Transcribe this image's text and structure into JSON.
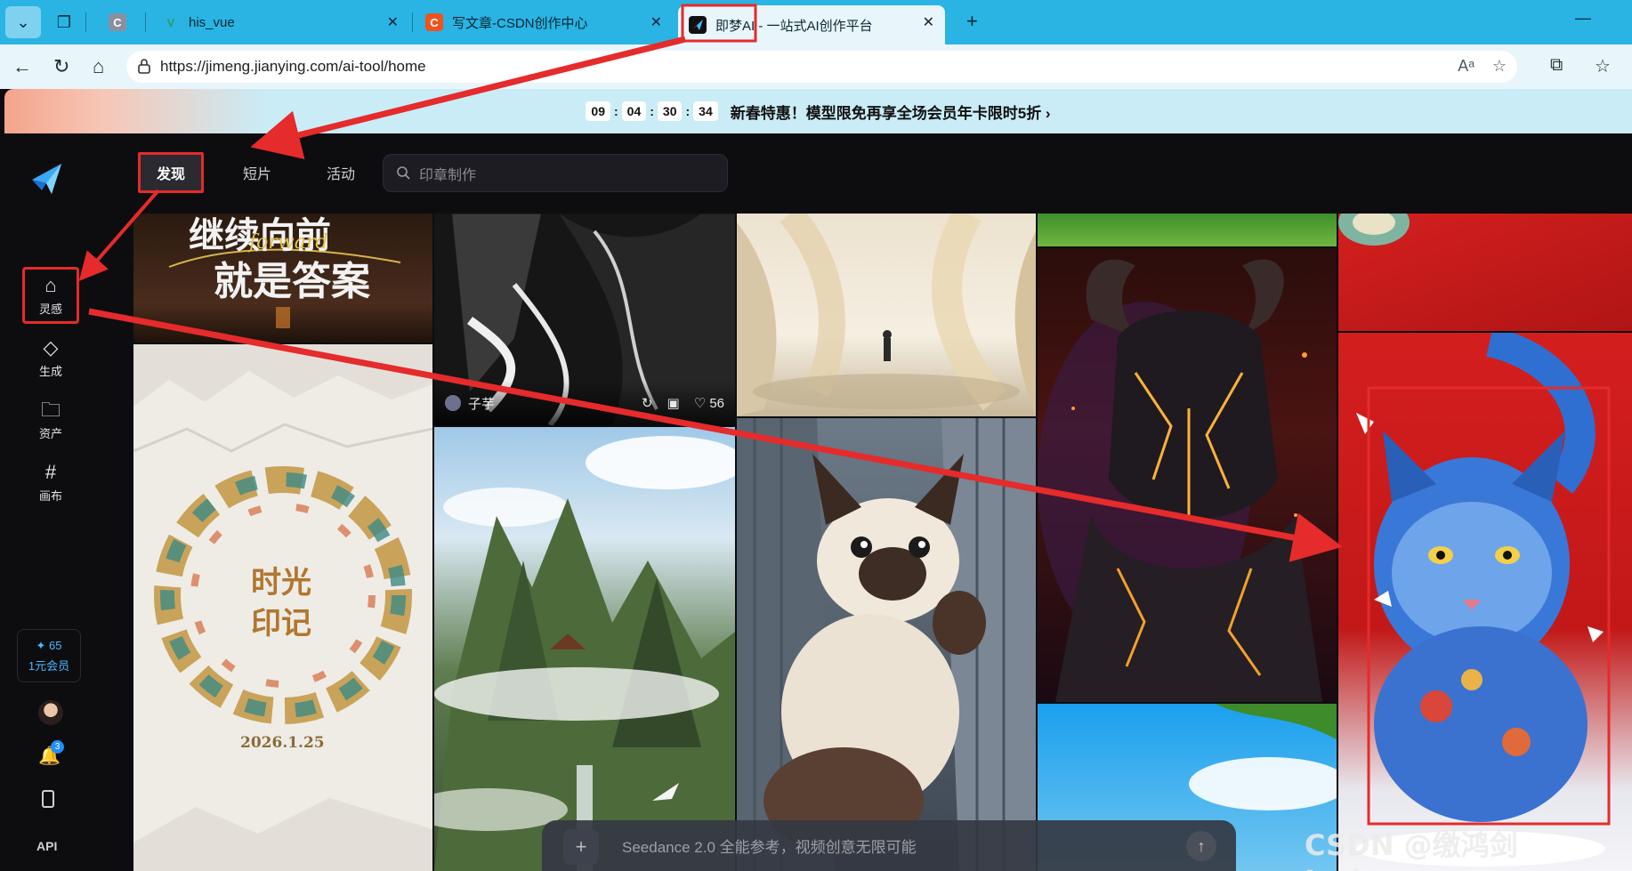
{
  "browser": {
    "tabs": [
      {
        "title": "",
        "favicon": "C"
      },
      {
        "title": "his_vue",
        "favicon": "V"
      },
      {
        "title": "写文章-CSDN创作中心",
        "favicon": "C"
      },
      {
        "title": "即梦AI - 一站式AI创作平台",
        "favicon": "jimeng-logo"
      }
    ],
    "new_tab": "+",
    "url": "https://jimeng.jianying.com/ai-tool/home"
  },
  "promo": {
    "timer": [
      "09",
      "04",
      "30",
      "34"
    ],
    "text": "新春特惠！模型限免再享全场会员年卡限时5折 ›"
  },
  "sidebar": {
    "items": [
      {
        "label": "灵感",
        "icon": "home-icon"
      },
      {
        "label": "生成",
        "icon": "diamond-icon"
      },
      {
        "label": "资产",
        "icon": "folder-icon"
      },
      {
        "label": "画布",
        "icon": "canvas-icon"
      }
    ],
    "credits": "✦ 65",
    "membership": "1元会员",
    "notification_count": "3",
    "api": "API"
  },
  "topnav": {
    "tabs": [
      "发现",
      "短片",
      "活动"
    ],
    "search_placeholder": "印章制作"
  },
  "card": {
    "author": "子芋",
    "likes": "56"
  },
  "tiles_text": {
    "calligraphy_line1": "继续向前",
    "calligraphy_script": "forward",
    "calligraphy_line2": "就是答案",
    "seal_line1": "时光",
    "seal_line2": "印记",
    "seal_date": "2026.1.25"
  },
  "prompt": {
    "placeholder": "Seedance 2.0 全能参考，视频创意无限可能",
    "plus": "+",
    "send": "↑"
  },
  "watermark": "CSDN @缴鸿剑Jackson",
  "colors": {
    "tab_bar": "#29b4e4",
    "address_bar": "#e8f6fb",
    "app_bg": "#0d0d10",
    "annotation_red": "#e52b2b",
    "accent_blue": "#4ab8ff"
  }
}
